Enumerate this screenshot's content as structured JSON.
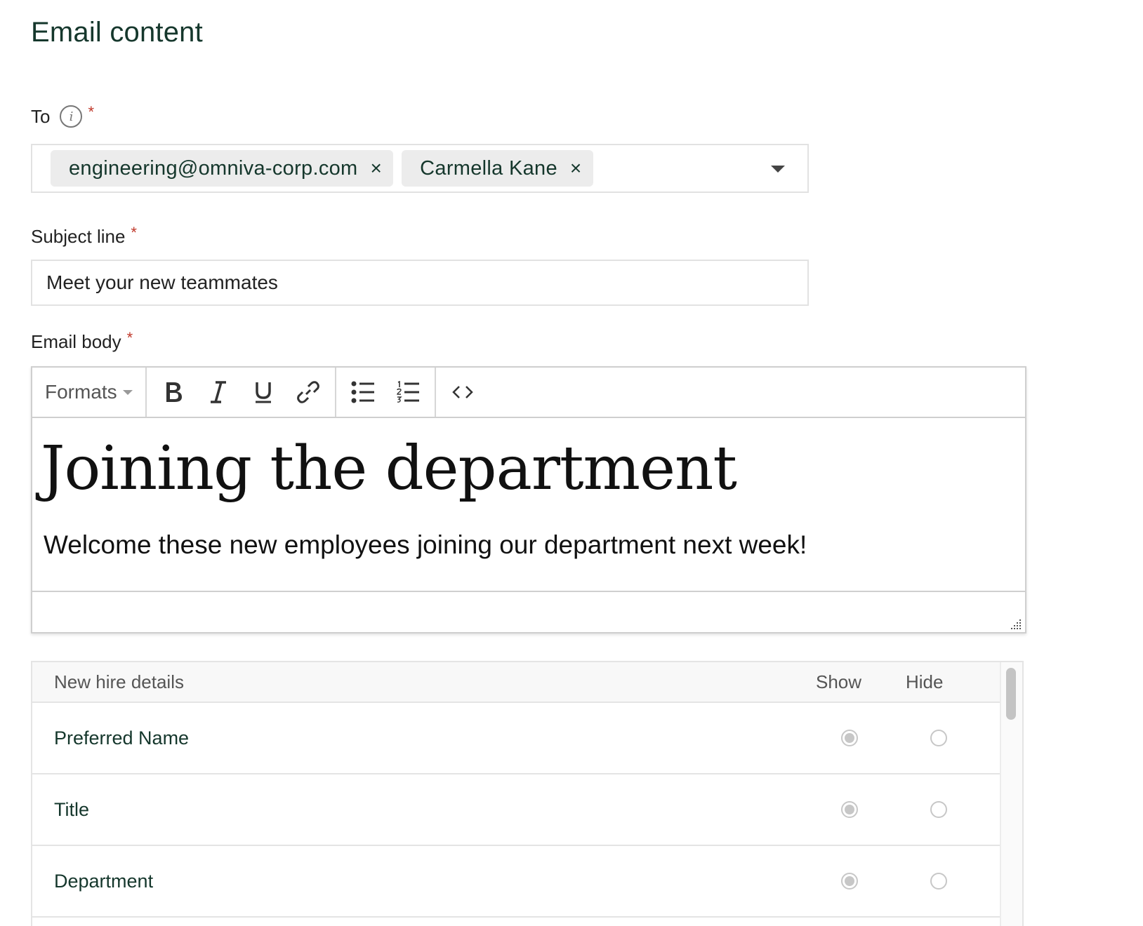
{
  "page": {
    "title": "Email content"
  },
  "to": {
    "label": "To",
    "required": "*",
    "info_icon": "i",
    "recipients": [
      {
        "label": "engineering@omniva-corp.com",
        "remove": "×"
      },
      {
        "label": "Carmella Kane",
        "remove": "×"
      }
    ]
  },
  "subject": {
    "label": "Subject line",
    "required": "*",
    "value": "Meet your new teammates"
  },
  "body": {
    "label": "Email body",
    "required": "*",
    "toolbar": {
      "formats_label": "Formats"
    },
    "heading": "Joining the department",
    "paragraph": "Welcome these new employees joining our department next week!"
  },
  "details": {
    "header": {
      "name": "New hire details",
      "show": "Show",
      "hide": "Hide"
    },
    "rows": [
      {
        "name": "Preferred Name",
        "selected": "show"
      },
      {
        "name": "Title",
        "selected": "show"
      },
      {
        "name": "Department",
        "selected": "show"
      }
    ]
  },
  "colors": {
    "brand_text": "#15372c",
    "required": "#c0392b",
    "radio": "#c7c7c7"
  },
  "icons": [
    "info-icon",
    "close-icon",
    "chevron-down-icon",
    "bold-icon",
    "italic-icon",
    "underline-icon",
    "link-icon",
    "bullet-list-icon",
    "numbered-list-icon",
    "code-icon",
    "resize-handle-icon"
  ]
}
